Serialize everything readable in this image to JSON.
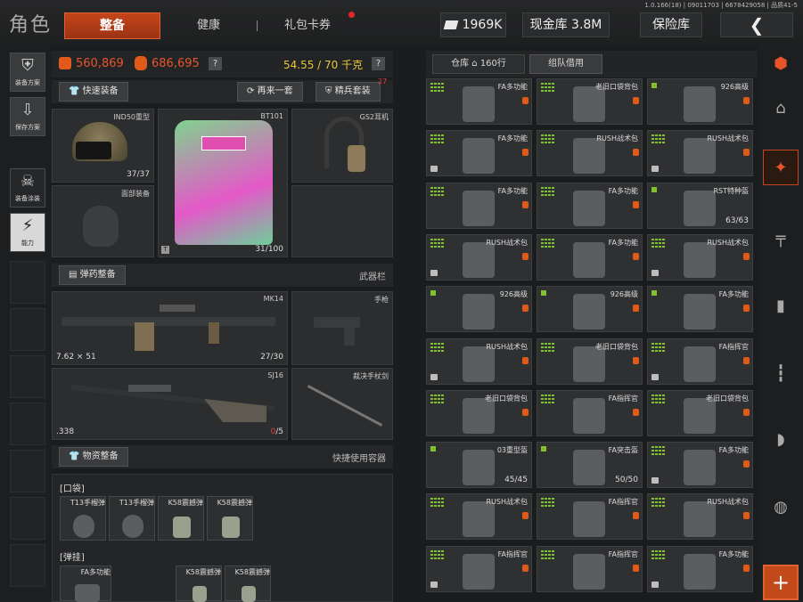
{
  "header": {
    "title": "角色",
    "tabs": [
      "整备",
      "健康",
      "礼包卡券"
    ],
    "build": "1.0.166(18) | 09011703 | 6678429058 | 品质41-5",
    "ticket_value": "1969K",
    "cash_vault": "现金库 3.8M",
    "safe_box": "保险库",
    "back_icon": "chevron-left-icon"
  },
  "left_nav": [
    {
      "label": "装备方案",
      "icon": "vest-icon"
    },
    {
      "label": "保存方案",
      "icon": "download-icon"
    },
    {
      "label": "装备涂装",
      "icon": "skin-icon"
    },
    {
      "label": "能力",
      "icon": "lightning-icon"
    }
  ],
  "stats": {
    "armor_value": "560,869",
    "bag_value": "686,695",
    "help": "?",
    "weight": "54.55 / 70 千克",
    "weight_help": "?"
  },
  "buttons": {
    "quick_equip": "快速装备",
    "again": "再来一套",
    "elite": "精兵套装",
    "elite_badge": "27"
  },
  "equipment": {
    "helmet": {
      "name": "IND50重型",
      "count": "37/37"
    },
    "armor": {
      "name": "BT101",
      "count": "31/100"
    },
    "headset": {
      "name": "GS2耳机"
    },
    "face": {
      "name": "面部装备"
    }
  },
  "ammo_section": {
    "label": "弹药整备",
    "right": "武器栏"
  },
  "weapons": {
    "primary": {
      "name": "MK14",
      "ammo": "7.62 × 51",
      "count": "27/30"
    },
    "pistol": {
      "name": "手枪"
    },
    "secondary": {
      "name": "SJ16",
      "ammo": ".338",
      "count_current": "0",
      "count_max": "/5"
    },
    "melee": {
      "name": "裁决手杖剑"
    }
  },
  "supply_section": {
    "label": "物资整备",
    "right": "快捷使用容器"
  },
  "pockets": {
    "label": "口袋",
    "items": [
      "T13手榴弹",
      "T13手榴弹",
      "K58震撼弹",
      "K58震撼弹"
    ]
  },
  "rig": {
    "label": "弹挂",
    "items": [
      "FA多功能",
      "K58震撼弹",
      "K58震撼弹"
    ]
  },
  "storage": {
    "tab_warehouse": "仓库",
    "tab_rows": "160行",
    "tab_team": "组队借用",
    "items": [
      {
        "name": "FA多功能",
        "icon": "grid"
      },
      {
        "name": "老旧口袋背包",
        "icon": "grid"
      },
      {
        "name": "926高级",
        "icon": "small"
      },
      {
        "name": "FA多功能",
        "icon": "grid"
      },
      {
        "name": "RUSH战术包",
        "icon": "grid"
      },
      {
        "name": "RUSH战术包",
        "icon": "grid"
      },
      {
        "name": "FA多功能",
        "icon": "grid"
      },
      {
        "name": "FA多功能",
        "icon": "grid"
      },
      {
        "name": "RST特种盔",
        "icon": "small",
        "count": "63/63"
      },
      {
        "name": "RUSH战术包",
        "icon": "grid"
      },
      {
        "name": "FA多功能",
        "icon": "grid"
      },
      {
        "name": "RUSH战术包",
        "icon": "grid"
      },
      {
        "name": "926高级",
        "icon": "small"
      },
      {
        "name": "926高级",
        "icon": "small"
      },
      {
        "name": "FA多功能",
        "icon": "small"
      },
      {
        "name": "RUSH战术包",
        "icon": "grid"
      },
      {
        "name": "老旧口袋背包",
        "icon": "grid"
      },
      {
        "name": "FA指挥官",
        "icon": "grid"
      },
      {
        "name": "老旧口袋背包",
        "icon": "grid"
      },
      {
        "name": "FA指挥官",
        "icon": "grid"
      },
      {
        "name": "老旧口袋背包",
        "icon": "grid"
      },
      {
        "name": "03重型盔",
        "icon": "small",
        "count": "45/45"
      },
      {
        "name": "FA突击盔",
        "icon": "small",
        "count": "50/50"
      },
      {
        "name": "FA多功能",
        "icon": "grid"
      },
      {
        "name": "RUSH战术包",
        "icon": "grid"
      },
      {
        "name": "FA指挥官",
        "icon": "grid"
      },
      {
        "name": "RUSH战术包",
        "icon": "grid"
      },
      {
        "name": "FA指挥官",
        "icon": "grid"
      },
      {
        "name": "FA指挥官",
        "icon": "grid"
      },
      {
        "name": "FA多功能",
        "icon": "grid"
      }
    ]
  },
  "right_nav": [
    "all-icon",
    "home-icon",
    "armor-icon",
    "rifle-icon",
    "magazine-icon",
    "ammo-icon",
    "grip-icon",
    "scope-icon"
  ],
  "add_button": "+"
}
